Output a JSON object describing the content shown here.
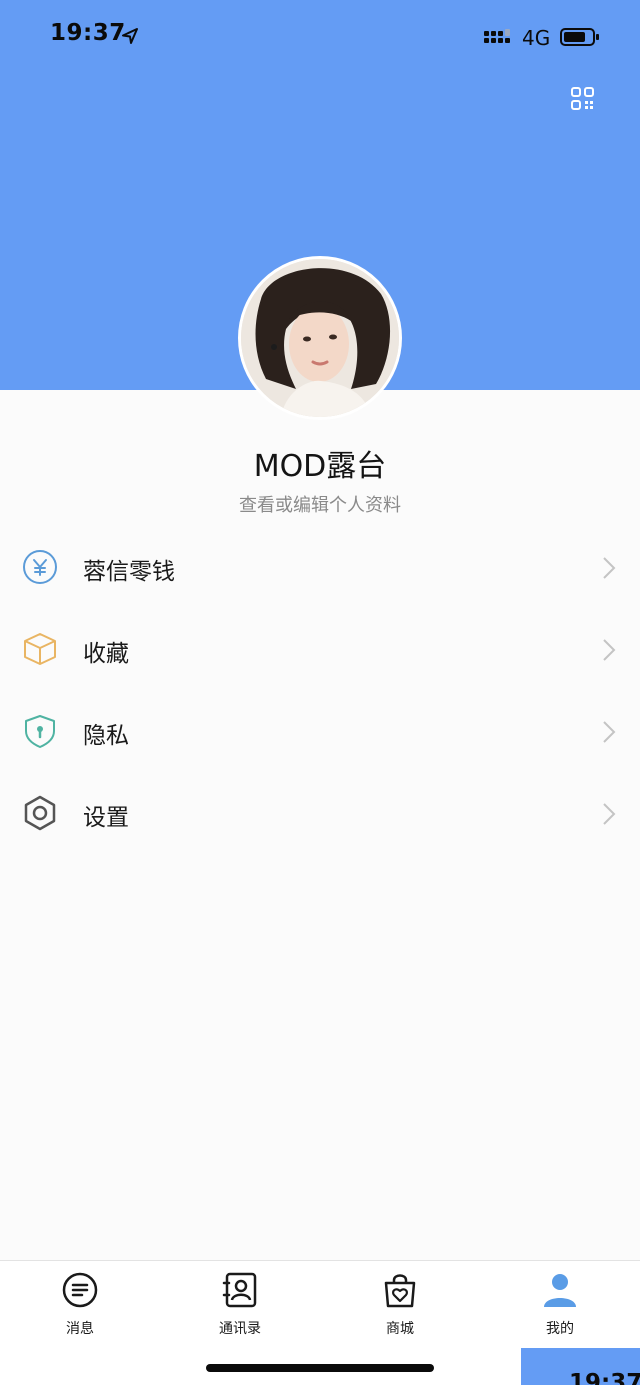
{
  "status_bar": {
    "time": "19:37",
    "network": "4G"
  },
  "colors": {
    "header_blue": "#649cf4",
    "money_icon": "#5b9bd8",
    "favorites_icon": "#e9b563",
    "privacy_icon": "#4fb3a2",
    "settings_icon": "#555555",
    "active_tab": "#5a9ce6"
  },
  "header": {
    "qr_icon": "qr-code-icon"
  },
  "profile": {
    "name": "MOD露台",
    "subtitle": "查看或编辑个人资料"
  },
  "menu": [
    {
      "label": "蓉信零钱",
      "icon": "yuan-wallet-icon"
    },
    {
      "label": "收藏",
      "icon": "box-icon"
    },
    {
      "label": "隐私",
      "icon": "shield-icon"
    },
    {
      "label": "设置",
      "icon": "gear-icon"
    }
  ],
  "tabs": [
    {
      "label": "消息",
      "icon": "chat-icon"
    },
    {
      "label": "通讯录",
      "icon": "contacts-icon"
    },
    {
      "label": "商城",
      "icon": "shopping-bag-icon"
    },
    {
      "label": "我的",
      "icon": "user-icon",
      "active": true
    }
  ],
  "overlay": {
    "time": "19:37"
  }
}
